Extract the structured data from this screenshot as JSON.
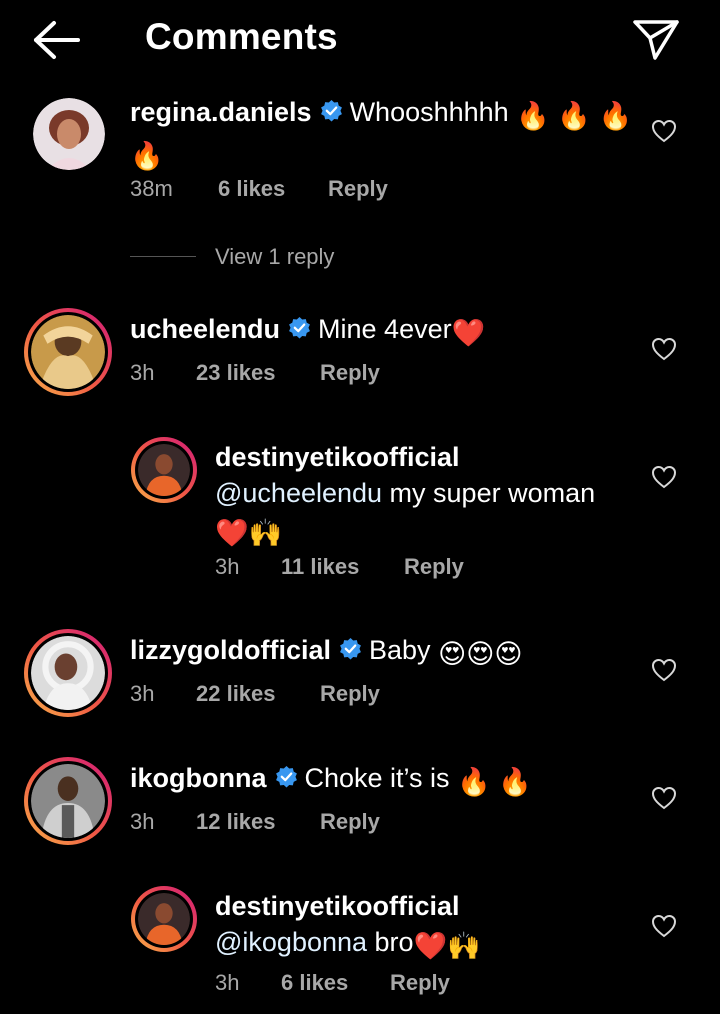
{
  "header": {
    "title": "Comments"
  },
  "icons": {
    "back": "arrow-left-icon",
    "send": "paper-plane-icon",
    "heart": "heart-outline-icon",
    "verified": "verified-badge-icon"
  },
  "colors": {
    "background": "#000000",
    "verified": "#3897f0",
    "meta": "#a8a8a8",
    "ring_start": "#f9b44a",
    "ring_end": "#d11a7a"
  },
  "comments": [
    {
      "username": "regina.daniels",
      "verified": true,
      "text": "Whooshhhhh",
      "emoji_line1": "🔥 🔥 🔥",
      "emoji_line2": "🔥",
      "time": "38m",
      "likes": "6 likes",
      "reply": "Reply",
      "view_replies": "View 1 reply"
    },
    {
      "username": "ucheelendu",
      "verified": true,
      "text": "Mine 4ever",
      "emoji": "❤️",
      "time": "3h",
      "likes": "23 likes",
      "reply": "Reply"
    },
    {
      "username": "destinyetikoofficial",
      "verified": false,
      "mention": "@ucheelendu",
      "text": " my super woman",
      "emoji_line2": "❤️🙌",
      "time": "3h",
      "likes": "11 likes",
      "reply": "Reply"
    },
    {
      "username": "lizzygoldofficial",
      "verified": true,
      "text": "Baby",
      "emoji": "😍😍😍",
      "time": "3h",
      "likes": "22 likes",
      "reply": "Reply"
    },
    {
      "username": "ikogbonna",
      "verified": true,
      "text": "Choke it’s is",
      "emoji": "🔥 🔥",
      "time": "3h",
      "likes": "12 likes",
      "reply": "Reply"
    },
    {
      "username": "destinyetikoofficial",
      "verified": false,
      "mention": "@ikogbonna",
      "text": " bro",
      "emoji": "❤️🙌",
      "time": "3h",
      "likes": "6 likes",
      "reply": "Reply"
    }
  ]
}
